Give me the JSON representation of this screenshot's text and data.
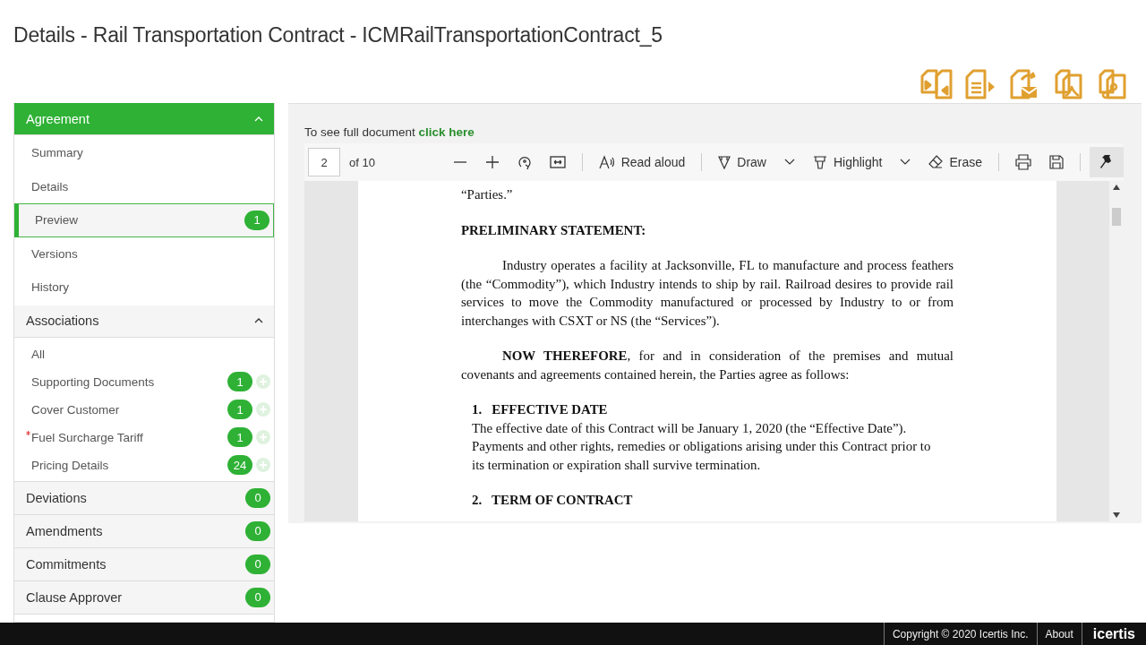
{
  "title": "Details - Rail Transportation Contract - ICMRailTransportationContract_5",
  "sidebar": {
    "sections": [
      {
        "kind": "group",
        "label": "Agreement",
        "selected": true,
        "expanded": true,
        "items": [
          {
            "label": "Summary",
            "selected": false
          },
          {
            "label": "Details",
            "selected": false
          },
          {
            "label": "Preview",
            "selected": true,
            "count": "1"
          },
          {
            "label": "Versions",
            "selected": false
          },
          {
            "label": "History",
            "selected": false
          }
        ]
      },
      {
        "kind": "group",
        "label": "Associations",
        "selected": false,
        "expanded": true,
        "items": [
          {
            "label": "All",
            "selected": false
          },
          {
            "label": "Supporting Documents",
            "selected": false,
            "count": "1",
            "addable": true,
            "required": false
          },
          {
            "label": "Cover Customer",
            "selected": false,
            "count": "1",
            "addable": true,
            "required": false
          },
          {
            "label": "Fuel Surcharge Tariff",
            "selected": false,
            "count": "1",
            "addable": true,
            "required": true
          },
          {
            "label": "Pricing Details",
            "selected": false,
            "count": "24",
            "addable": true,
            "required": false
          }
        ]
      },
      {
        "kind": "link",
        "label": "Deviations",
        "count": "0"
      },
      {
        "kind": "link",
        "label": "Amendments",
        "count": "0"
      },
      {
        "kind": "link",
        "label": "Commitments",
        "count": "0"
      },
      {
        "kind": "link",
        "label": "Clause Approver",
        "count": "0"
      }
    ]
  },
  "viewer": {
    "notice": "To see full document",
    "notice_link": "click here",
    "toolbar": {
      "page": "2",
      "page_total": "of 10",
      "read_aloud": "Read aloud",
      "draw": "Draw",
      "highlight": "Highlight",
      "erase": "Erase",
      "pinned": true
    },
    "document": [
      {
        "kind": "text",
        "text": "“Parties.”"
      },
      {
        "kind": "heading",
        "text": "PRELIMINARY STATEMENT:"
      },
      {
        "kind": "indent",
        "text": "Industry operates a facility at Jacksonville, FL to manufacture and process feathers (the “Commodity”), which Industry intends to ship by rail.  Railroad desires to provide rail services to move the Commodity manufactured or processed by Industry to or from interchanges with CSXT or NS (the “Services”)."
      },
      {
        "kind": "indent",
        "text": "**NOW THEREFORE**, for and in consideration of the premises and mutual covenants and agreements contained herein, the Parties agree as follows:"
      },
      {
        "kind": "numbered",
        "number": "1.",
        "title": "EFFECTIVE DATE",
        "text": "The effective date of this Contract will be January 1, 2020 (the “Effective Date”). Payments and other rights, remedies or obligations arising under this Contract prior to its termination or expiration shall survive termination."
      },
      {
        "kind": "numbered",
        "number": "2.",
        "title": "TERM OF CONTRACT"
      }
    ]
  },
  "footer": {
    "copyright": "Copyright © 2020 Icertis Inc.",
    "about": "About",
    "logo": "icertis"
  }
}
